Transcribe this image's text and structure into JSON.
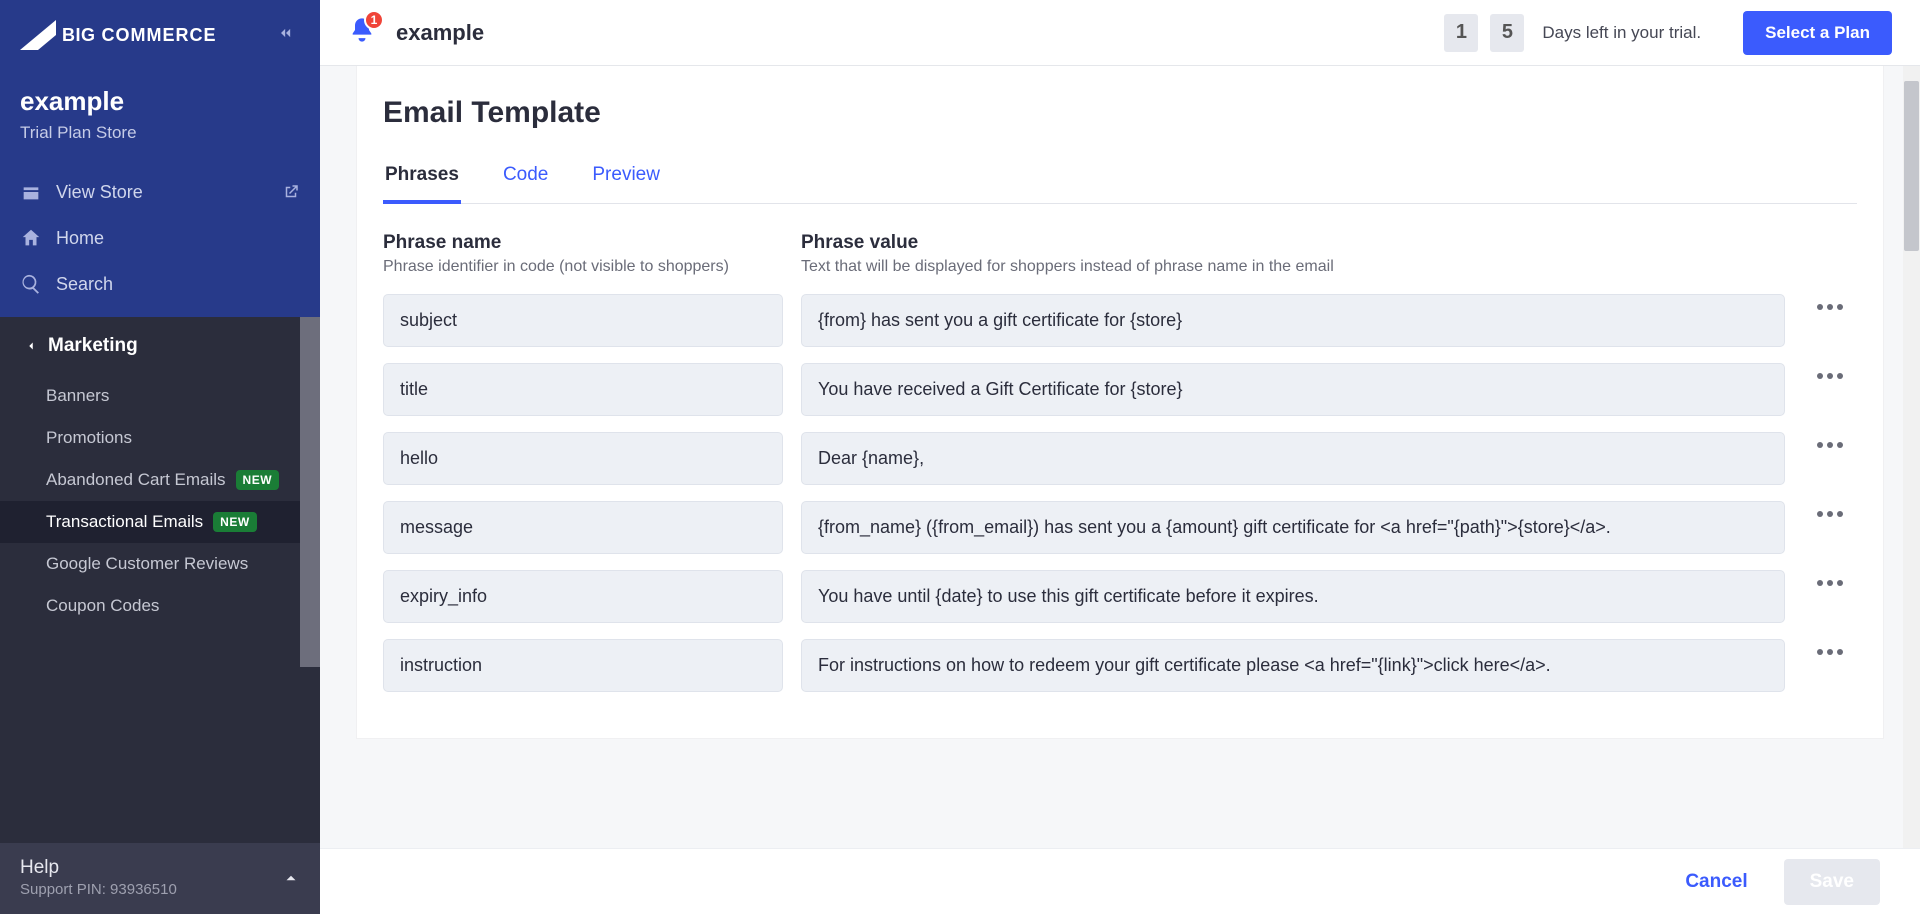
{
  "brand": "COMMERCE",
  "store": {
    "name": "example",
    "plan": "Trial Plan Store"
  },
  "topNav": {
    "viewStore": "View Store",
    "home": "Home",
    "search": "Search"
  },
  "section": {
    "title": "Marketing",
    "items": [
      {
        "label": "Banners",
        "new": false,
        "active": false
      },
      {
        "label": "Promotions",
        "new": false,
        "active": false
      },
      {
        "label": "Abandoned Cart Emails",
        "new": true,
        "active": false
      },
      {
        "label": "Transactional Emails",
        "new": true,
        "active": true
      },
      {
        "label": "Google Customer Reviews",
        "new": false,
        "active": false
      },
      {
        "label": "Coupon Codes",
        "new": false,
        "active": false
      }
    ],
    "newBadge": "NEW"
  },
  "help": {
    "title": "Help",
    "pin": "Support PIN: 93936510"
  },
  "header": {
    "notifCount": "1",
    "title": "example",
    "trialDigits": [
      "1",
      "5"
    ],
    "trialText": "Days left in your trial.",
    "selectPlan": "Select a Plan"
  },
  "page": {
    "title": "Email Template",
    "tabs": [
      {
        "label": "Phrases",
        "active": true
      },
      {
        "label": "Code",
        "active": false
      },
      {
        "label": "Preview",
        "active": false
      }
    ],
    "nameCol": {
      "head": "Phrase name",
      "sub": "Phrase identifier in code (not visible to shoppers)"
    },
    "valueCol": {
      "head": "Phrase value",
      "sub": "Text that will be displayed for shoppers instead of phrase name in the email"
    },
    "rows": [
      {
        "name": "subject",
        "value": "{from} has sent you a gift certificate for {store}"
      },
      {
        "name": "title",
        "value": "You have received a Gift Certificate for {store}"
      },
      {
        "name": "hello",
        "value": "Dear {name},"
      },
      {
        "name": "message",
        "value": "{from_name} ({from_email}) has sent you a {amount} gift certificate for <a href=\"{path}\">{store}</a>."
      },
      {
        "name": "expiry_info",
        "value": "You have until {date} to use this gift certificate before it expires."
      },
      {
        "name": "instruction",
        "value": "For instructions on how to redeem your gift certificate please <a href=\"{link}\">click here</a>."
      }
    ]
  },
  "footer": {
    "cancel": "Cancel",
    "save": "Save"
  }
}
